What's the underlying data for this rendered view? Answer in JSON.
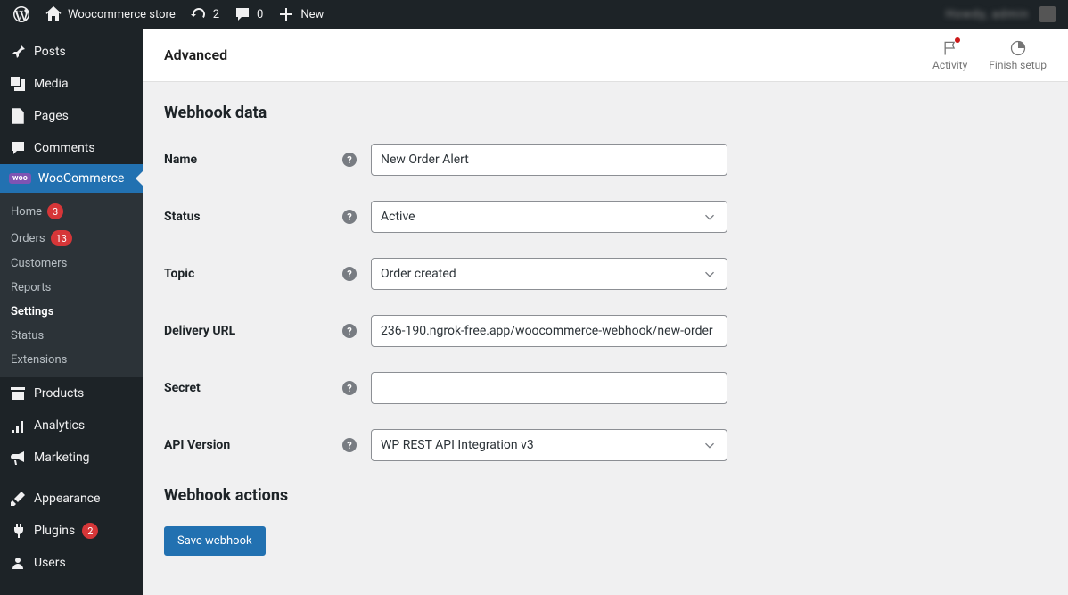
{
  "adminbar": {
    "site_name": "Woocommerce store",
    "refresh_count": "2",
    "comments_count": "0",
    "new_label": "New",
    "user_display": "Howdy, admin"
  },
  "sidebar": {
    "items": [
      {
        "label": "Posts",
        "icon": "pin"
      },
      {
        "label": "Media",
        "icon": "media"
      },
      {
        "label": "Pages",
        "icon": "page"
      },
      {
        "label": "Comments",
        "icon": "comment"
      },
      {
        "label": "WooCommerce",
        "icon": "woo",
        "current": true
      },
      {
        "label": "Products",
        "icon": "archive"
      },
      {
        "label": "Analytics",
        "icon": "analytics"
      },
      {
        "label": "Marketing",
        "icon": "megaphone"
      },
      {
        "label": "Appearance",
        "icon": "brush"
      },
      {
        "label": "Plugins",
        "icon": "plugin",
        "badge": "2"
      },
      {
        "label": "Users",
        "icon": "users"
      }
    ],
    "submenu": [
      {
        "label": "Home",
        "badge": "3"
      },
      {
        "label": "Orders",
        "badge": "13"
      },
      {
        "label": "Customers"
      },
      {
        "label": "Reports"
      },
      {
        "label": "Settings",
        "active": true
      },
      {
        "label": "Status"
      },
      {
        "label": "Extensions"
      }
    ]
  },
  "topbar": {
    "title": "Advanced",
    "actions": [
      {
        "label": "Activity",
        "icon": "flag",
        "dot": true
      },
      {
        "label": "Finish setup",
        "icon": "progress"
      }
    ]
  },
  "form": {
    "section_title": "Webhook data",
    "fields": {
      "name": {
        "label": "Name",
        "value": "New Order Alert"
      },
      "status": {
        "label": "Status",
        "value": "Active"
      },
      "topic": {
        "label": "Topic",
        "value": "Order created"
      },
      "delivery_url": {
        "label": "Delivery URL",
        "value": "236-190.ngrok-free.app/woocommerce-webhook/new-order"
      },
      "secret": {
        "label": "Secret",
        "value": ""
      },
      "api_version": {
        "label": "API Version",
        "value": "WP REST API Integration v3"
      }
    },
    "actions_title": "Webhook actions",
    "save_label": "Save webhook"
  }
}
